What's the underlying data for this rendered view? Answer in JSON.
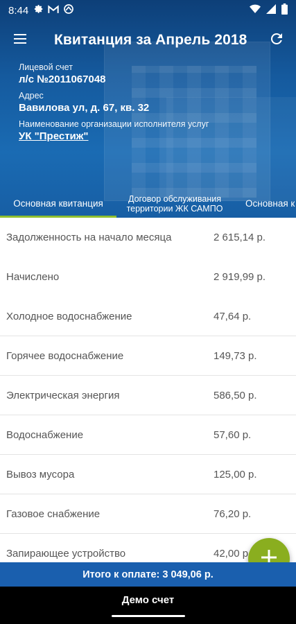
{
  "status_bar": {
    "time": "8:44",
    "icons_left": [
      "gear-icon",
      "gmail-icon",
      "app-icon"
    ],
    "icons_right": [
      "wifi-icon",
      "signal-icon",
      "battery-icon"
    ]
  },
  "app_bar": {
    "title": "Квитанция за Апрель 2018",
    "menu_icon": "menu-icon",
    "refresh_icon": "refresh-icon"
  },
  "info": {
    "account_label": "Лицевой счет",
    "account_value": "л/с №2011067048",
    "address_label": "Адрес",
    "address_value": "Вавилова ул, д. 67, кв. 32",
    "org_label": "Наименование организации исполнителя услуг",
    "org_value": "УК \"Престиж\""
  },
  "tabs": [
    {
      "label": "Основная квитанция",
      "active": true
    },
    {
      "label_line1": "Договор обслуживания",
      "label_line2": "территории ЖК САМПО",
      "active": false
    },
    {
      "label": "Основная к",
      "active": false
    }
  ],
  "summary": [
    {
      "name": "Задолженность на начало месяца",
      "amount": "2 615,14 р."
    },
    {
      "name": "Начислено",
      "amount": "2 919,99 р."
    }
  ],
  "services": [
    {
      "name": "Холодное водоснабжение",
      "amount": "47,64 р."
    },
    {
      "name": "Горячее водоснабжение",
      "amount": "149,73 р."
    },
    {
      "name": "Электрическая энергия",
      "amount": "586,50 р."
    },
    {
      "name": "Водоснабжение",
      "amount": "57,60 р."
    },
    {
      "name": "Вывоз мусора",
      "amount": "125,00 р."
    },
    {
      "name": "Газовое снабжение",
      "amount": "76,20 р."
    },
    {
      "name": "Запирающее устройство",
      "amount": "42,00 р."
    }
  ],
  "total": "Итого к оплате: 3 049,06 р.",
  "bottom_nav": {
    "label": "Демо счет"
  },
  "colors": {
    "primary": "#1a5fae",
    "accent": "#8aae1f",
    "header_dark": "#0d3f78"
  }
}
